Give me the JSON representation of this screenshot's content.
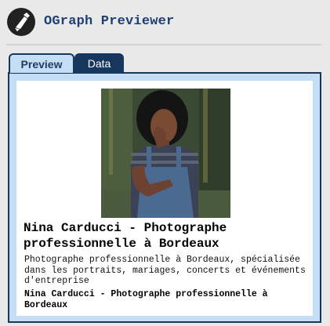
{
  "app": {
    "title": "OGraph Previewer",
    "logo_icon": "pen-nib-icon"
  },
  "tabs": [
    {
      "label": "Preview",
      "active": true
    },
    {
      "label": "Data",
      "active": false
    }
  ],
  "preview": {
    "image_subject": "portrait photo of a woman in a striped top and denim overalls",
    "title": "Nina Carducci - Photographe professionnelle à Bordeaux",
    "description": "Photographe professionnelle à Bordeaux, spécialisée dans les portraits, mariages, concerts et événements d'entreprise",
    "site_name": "Nina Carducci - Photographe professionnelle à Bordeaux"
  },
  "colors": {
    "accent": "#17375e",
    "panel_background": "#c6def5",
    "title_text": "#1f3f73"
  }
}
